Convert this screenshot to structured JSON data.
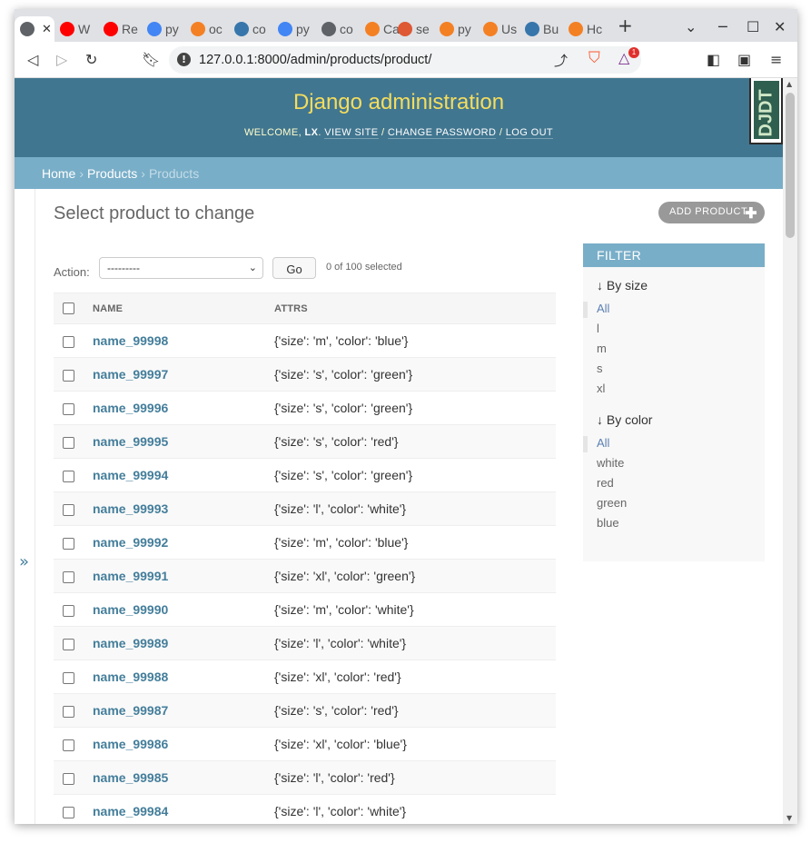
{
  "browser": {
    "tabs": [
      {
        "title": "",
        "icon": "globe-icon",
        "color": "#5f6368",
        "active": true
      },
      {
        "title": "W",
        "icon": "youtube-icon",
        "color": "#ff0000"
      },
      {
        "title": "Re",
        "icon": "youtube-icon",
        "color": "#ff0000"
      },
      {
        "title": "py",
        "icon": "google-icon",
        "color": "#4285f4"
      },
      {
        "title": "oc",
        "icon": "stackoverflow-icon",
        "color": "#f48024"
      },
      {
        "title": "co",
        "icon": "python-icon",
        "color": "#3776ab"
      },
      {
        "title": "py",
        "icon": "google-icon",
        "color": "#4285f4"
      },
      {
        "title": "co",
        "icon": "globe-icon",
        "color": "#5f6368"
      },
      {
        "title": "Ca",
        "icon": "stackoverflow-icon",
        "color": "#f48024"
      },
      {
        "title": "se",
        "icon": "duckduckgo-icon",
        "color": "#de5833"
      },
      {
        "title": "py",
        "icon": "stackoverflow-icon",
        "color": "#f48024"
      },
      {
        "title": "Us",
        "icon": "stackoverflow-icon",
        "color": "#f48024"
      },
      {
        "title": "Bu",
        "icon": "python-icon",
        "color": "#3776ab"
      },
      {
        "title": "Hc",
        "icon": "stackoverflow-icon",
        "color": "#f48024"
      }
    ],
    "url": "127.0.0.1:8000/admin/products/product/",
    "notification_count": "1"
  },
  "header": {
    "site_name": "Django administration",
    "welcome": "WELCOME,",
    "user": "LX",
    "view_site": "VIEW SITE",
    "change_password": "CHANGE PASSWORD",
    "log_out": "LOG OUT",
    "djdt": "DJDT"
  },
  "breadcrumbs": {
    "home": "Home",
    "app": "Products",
    "current": "Products"
  },
  "content": {
    "title": "Select product to change",
    "add_button": "ADD PRODUCT",
    "action_label": "Action:",
    "action_value": "---------",
    "go_label": "Go",
    "counter": "0 of 100 selected",
    "columns": [
      "NAME",
      "ATTRS"
    ],
    "rows": [
      {
        "name": "name_99998",
        "attrs": "{'size': 'm', 'color': 'blue'}"
      },
      {
        "name": "name_99997",
        "attrs": "{'size': 's', 'color': 'green'}"
      },
      {
        "name": "name_99996",
        "attrs": "{'size': 's', 'color': 'green'}"
      },
      {
        "name": "name_99995",
        "attrs": "{'size': 's', 'color': 'red'}"
      },
      {
        "name": "name_99994",
        "attrs": "{'size': 's', 'color': 'green'}"
      },
      {
        "name": "name_99993",
        "attrs": "{'size': 'l', 'color': 'white'}"
      },
      {
        "name": "name_99992",
        "attrs": "{'size': 'm', 'color': 'blue'}"
      },
      {
        "name": "name_99991",
        "attrs": "{'size': 'xl', 'color': 'green'}"
      },
      {
        "name": "name_99990",
        "attrs": "{'size': 'm', 'color': 'white'}"
      },
      {
        "name": "name_99989",
        "attrs": "{'size': 'l', 'color': 'white'}"
      },
      {
        "name": "name_99988",
        "attrs": "{'size': 'xl', 'color': 'red'}"
      },
      {
        "name": "name_99987",
        "attrs": "{'size': 's', 'color': 'red'}"
      },
      {
        "name": "name_99986",
        "attrs": "{'size': 'xl', 'color': 'blue'}"
      },
      {
        "name": "name_99985",
        "attrs": "{'size': 'l', 'color': 'red'}"
      },
      {
        "name": "name_99984",
        "attrs": "{'size': 'l', 'color': 'white'}"
      }
    ]
  },
  "filter": {
    "heading": "FILTER",
    "groups": [
      {
        "title": "↓ By size",
        "options": [
          "All",
          "l",
          "m",
          "s",
          "xl"
        ]
      },
      {
        "title": "↓ By color",
        "options": [
          "All",
          "white",
          "red",
          "green",
          "blue"
        ]
      }
    ]
  }
}
